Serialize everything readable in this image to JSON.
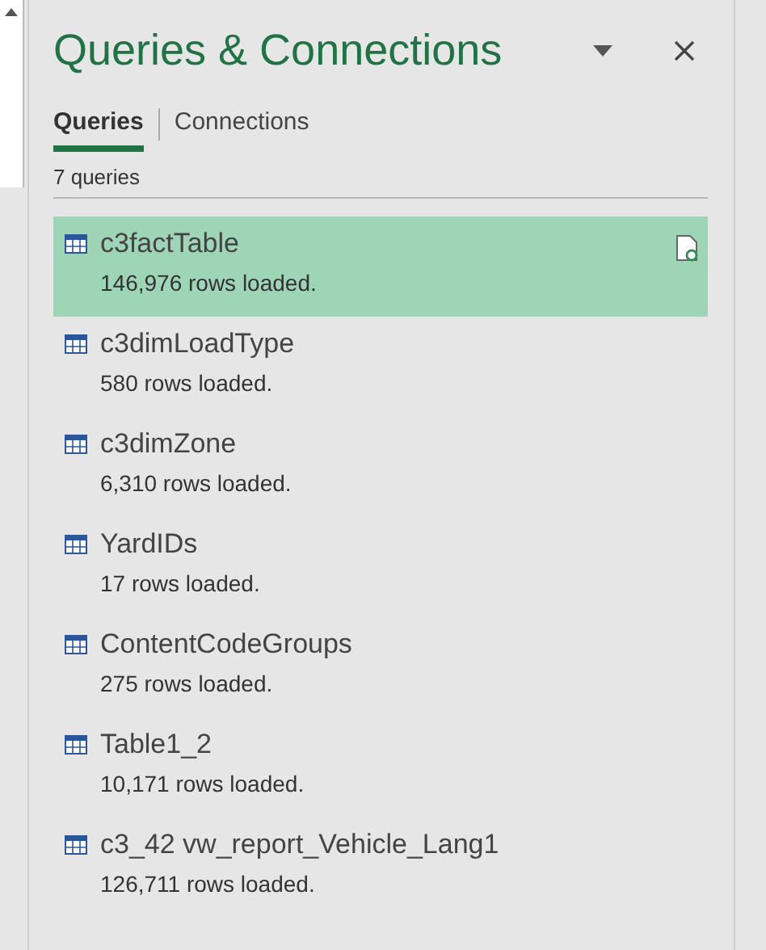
{
  "pane": {
    "title": "Queries & Connections"
  },
  "tabs": [
    {
      "label": "Queries",
      "selected": true
    },
    {
      "label": "Connections",
      "selected": false
    }
  ],
  "count": "7 queries",
  "queries": [
    {
      "name": "c3factTable",
      "status": "146,976 rows loaded.",
      "selected": true
    },
    {
      "name": "c3dimLoadType",
      "status": "580 rows loaded.",
      "selected": false
    },
    {
      "name": "c3dimZone",
      "status": "6,310 rows loaded.",
      "selected": false
    },
    {
      "name": "YardIDs",
      "status": "17 rows loaded.",
      "selected": false
    },
    {
      "name": "ContentCodeGroups",
      "status": "275 rows loaded.",
      "selected": false
    },
    {
      "name": "Table1_2",
      "status": "10,171 rows loaded.",
      "selected": false
    },
    {
      "name": "c3_42 vw_report_Vehicle_Lang1",
      "status": "126,711 rows loaded.",
      "selected": false
    }
  ]
}
